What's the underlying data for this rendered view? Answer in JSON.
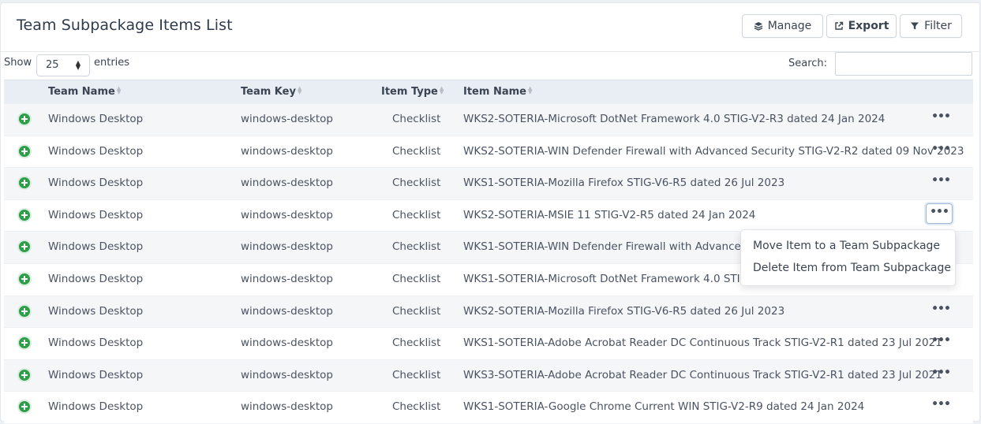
{
  "header": {
    "title": "Team Subpackage Items List",
    "buttons": {
      "manage": "Manage",
      "export": "Export",
      "filter": "Filter"
    }
  },
  "controls": {
    "show_label": "Show",
    "entries_value": "25",
    "entries_label": "entries",
    "search_label": "Search:",
    "search_value": ""
  },
  "table": {
    "columns": [
      "Team Name",
      "Team Key",
      "Item Type",
      "Item Name"
    ],
    "rows": [
      {
        "team_name": "Windows Desktop",
        "team_key": "windows-desktop",
        "item_type": "Checklist",
        "item_name": "WKS2-SOTERIA-Microsoft DotNet Framework 4.0 STIG-V2-R3 dated 24 Jan 2024"
      },
      {
        "team_name": "Windows Desktop",
        "team_key": "windows-desktop",
        "item_type": "Checklist",
        "item_name": "WKS2-SOTERIA-WIN Defender Firewall with Advanced Security STIG-V2-R2 dated 09 Nov 2023"
      },
      {
        "team_name": "Windows Desktop",
        "team_key": "windows-desktop",
        "item_type": "Checklist",
        "item_name": "WKS1-SOTERIA-Mozilla Firefox STIG-V6-R5 dated 26 Jul 2023"
      },
      {
        "team_name": "Windows Desktop",
        "team_key": "windows-desktop",
        "item_type": "Checklist",
        "item_name": "WKS2-SOTERIA-MSIE 11 STIG-V2-R5 dated 24 Jan 2024"
      },
      {
        "team_name": "Windows Desktop",
        "team_key": "windows-desktop",
        "item_type": "Checklist",
        "item_name": "WKS1-SOTERIA-WIN Defender Firewall with Advanced Se"
      },
      {
        "team_name": "Windows Desktop",
        "team_key": "windows-desktop",
        "item_type": "Checklist",
        "item_name": "WKS1-SOTERIA-Microsoft DotNet Framework 4.0 STIG-V"
      },
      {
        "team_name": "Windows Desktop",
        "team_key": "windows-desktop",
        "item_type": "Checklist",
        "item_name": "WKS2-SOTERIA-Mozilla Firefox STIG-V6-R5 dated 26 Jul 2023"
      },
      {
        "team_name": "Windows Desktop",
        "team_key": "windows-desktop",
        "item_type": "Checklist",
        "item_name": "WKS1-SOTERIA-Adobe Acrobat Reader DC Continuous Track STIG-V2-R1 dated 23 Jul 2021"
      },
      {
        "team_name": "Windows Desktop",
        "team_key": "windows-desktop",
        "item_type": "Checklist",
        "item_name": "WKS3-SOTERIA-Adobe Acrobat Reader DC Continuous Track STIG-V2-R1 dated 23 Jul 2021"
      },
      {
        "team_name": "Windows Desktop",
        "team_key": "windows-desktop",
        "item_type": "Checklist",
        "item_name": "WKS1-SOTERIA-Google Chrome Current WIN STIG-V2-R9 dated 24 Jan 2024"
      }
    ],
    "actions_glyph": "•••",
    "active_row_index": 3
  },
  "row_menu": {
    "items": [
      "Move Item to a Team Subpackage",
      "Delete Item from Team Subpackage"
    ]
  },
  "colors": {
    "accent_green": "#2e9e48",
    "header_bg": "#e9edf4",
    "focus_border": "#9fb6d2"
  }
}
